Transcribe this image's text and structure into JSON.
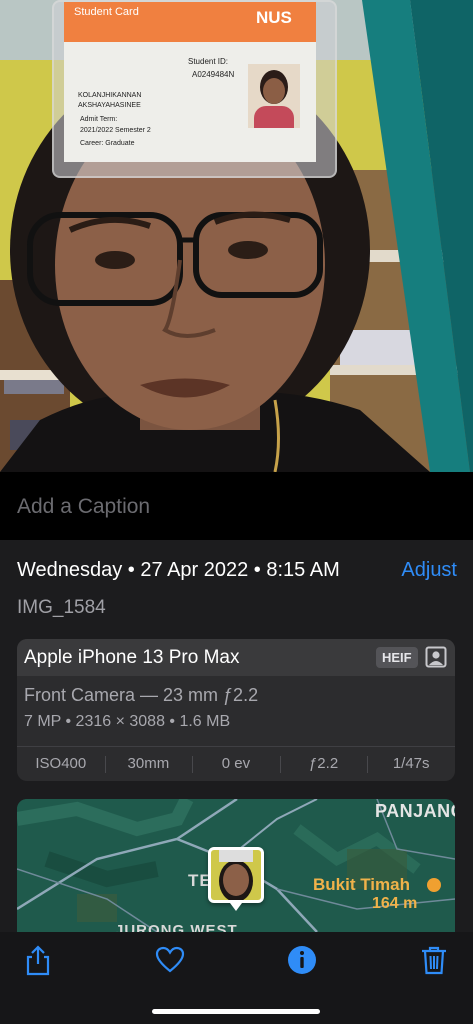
{
  "photo": {
    "id_card": {
      "header": "Student Card",
      "university": "NUS",
      "student_id_label": "Student ID:",
      "student_id": "A0249484N",
      "name_line1": "KOLANJHIKANNAN",
      "name_line2": "AKSHAYAHASINEE",
      "admit_term_label": "Admit Term:",
      "admit_term": "2021/2022 Semester 2",
      "career": "Career:  Graduate"
    }
  },
  "caption": {
    "placeholder": "Add a Caption",
    "value": ""
  },
  "info": {
    "datetime": "Wednesday • 27 Apr 2022 • 8:15 AM",
    "adjust_label": "Adjust",
    "filename": "IMG_1584",
    "camera": {
      "device": "Apple iPhone 13 Pro Max",
      "format_badge": "HEIF",
      "format_icon": "portrait-icon",
      "lens": "Front Camera — 23 mm ƒ2.2",
      "specs": "7 MP  •  2316 × 3088  •  1.6 MB",
      "exif": [
        "ISO400",
        "30mm",
        "0 ev",
        "ƒ2.2",
        "1/47s"
      ]
    },
    "map": {
      "labels": {
        "panjang": "PANJANG",
        "bukit_timah": "Bukit Timah",
        "elevation": "164 m",
        "te": "TE",
        "jurong_west": "JURONG WEST"
      },
      "peak_icon": "mountain-peak-icon"
    }
  },
  "toolbar": {
    "icons": [
      "share-icon",
      "heart-icon",
      "info-icon",
      "trash-icon"
    ],
    "accent_color": "#2f8cf7"
  },
  "colors": {
    "accent": "#2f8cf7",
    "panel_bg": "#1c1c1e",
    "card_bg": "#2c2c2e",
    "map_label_orange": "#f0b24a"
  }
}
